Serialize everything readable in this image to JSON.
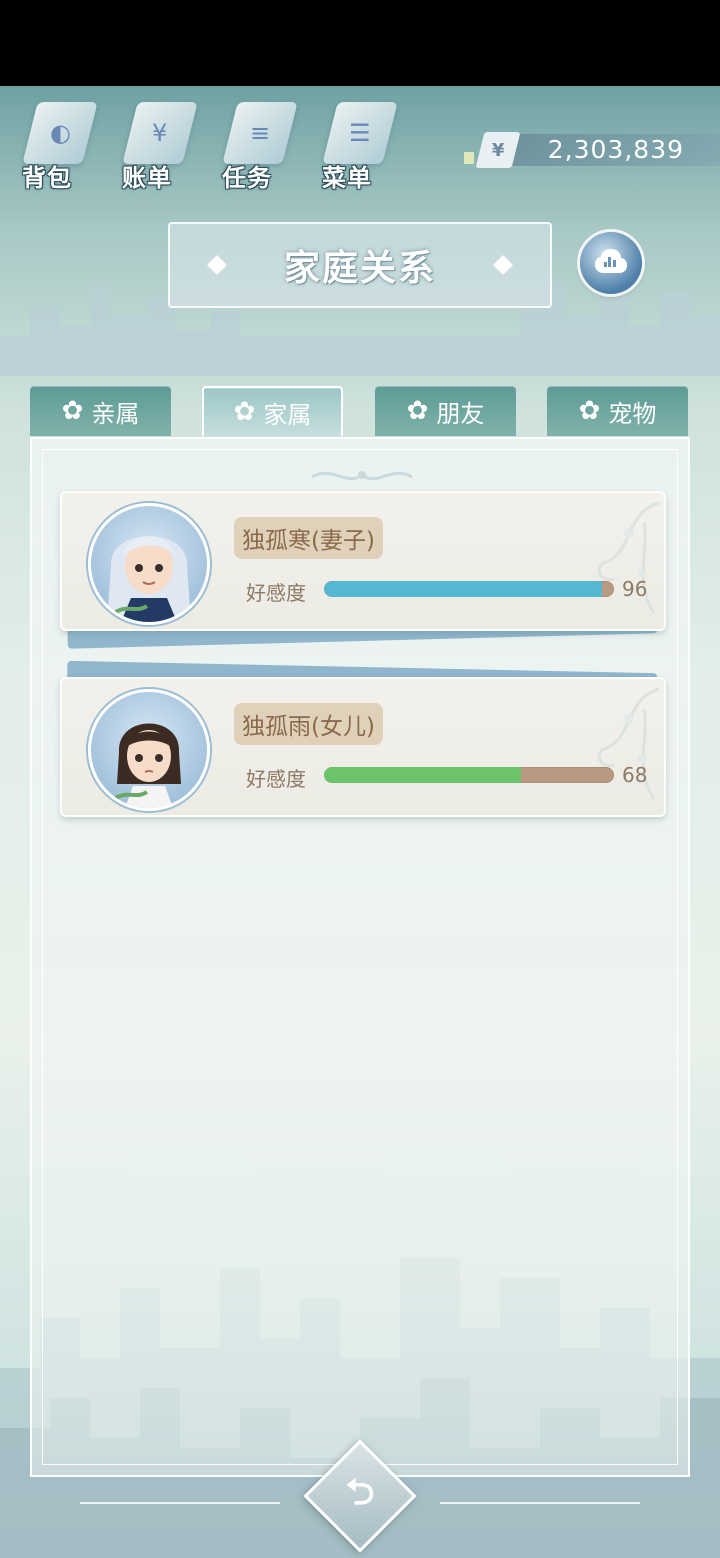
{
  "toolbar": {
    "items": [
      {
        "label": "背包",
        "icon": "bag-icon"
      },
      {
        "label": "账单",
        "icon": "bill-icon"
      },
      {
        "label": "任务",
        "icon": "task-icon"
      },
      {
        "label": "菜单",
        "icon": "menu-icon"
      }
    ]
  },
  "money": {
    "symbol": "¥",
    "amount": "2,303,839"
  },
  "title": "家庭关系",
  "tabs": [
    {
      "label": "亲属",
      "active": false
    },
    {
      "label": "家属",
      "active": true
    },
    {
      "label": "朋友",
      "active": false
    },
    {
      "label": "宠物",
      "active": false
    }
  ],
  "members": [
    {
      "name": "独孤寒(妻子)",
      "fav_label": "好感度",
      "favor": 96,
      "bar_color": "#57b6d2",
      "avatar": "wife-avatar"
    },
    {
      "name": "独孤雨(女儿)",
      "fav_label": "好感度",
      "favor": 68,
      "bar_color": "#6bc46b",
      "avatar": "daughter-avatar"
    }
  ],
  "colors": {
    "accent": "#5e9a95",
    "panel": "#ecf3f0",
    "chip": "#d7c0a0"
  }
}
